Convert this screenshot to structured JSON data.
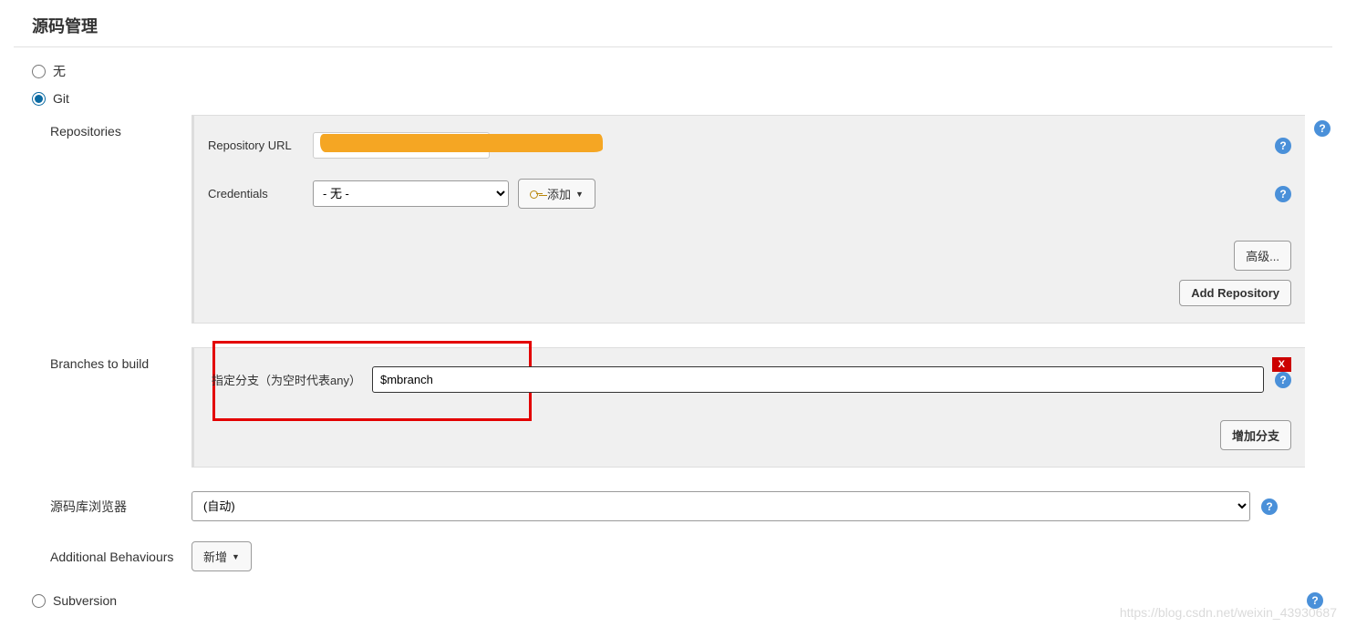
{
  "section": {
    "title": "源码管理"
  },
  "scm": {
    "none_label": "无",
    "git_label": "Git",
    "subversion_label": "Subversion"
  },
  "repositories": {
    "label": "Repositories",
    "url_label": "Repository URL",
    "url_value": "",
    "credentials_label": "Credentials",
    "credentials_selected": "- 无 -",
    "add_cred_label": "添加",
    "advanced_label": "高级...",
    "add_repo_label": "Add Repository"
  },
  "branches": {
    "label": "Branches to build",
    "branch_label": "指定分支（为空时代表any）",
    "branch_value": "$mbranch",
    "delete_label": "X",
    "add_branch_label": "增加分支"
  },
  "browser": {
    "label": "源码库浏览器",
    "selected": "(自动)"
  },
  "behaviours": {
    "label": "Additional Behaviours",
    "add_label": "新增"
  },
  "watermark": "https://blog.csdn.net/weixin_43930687"
}
